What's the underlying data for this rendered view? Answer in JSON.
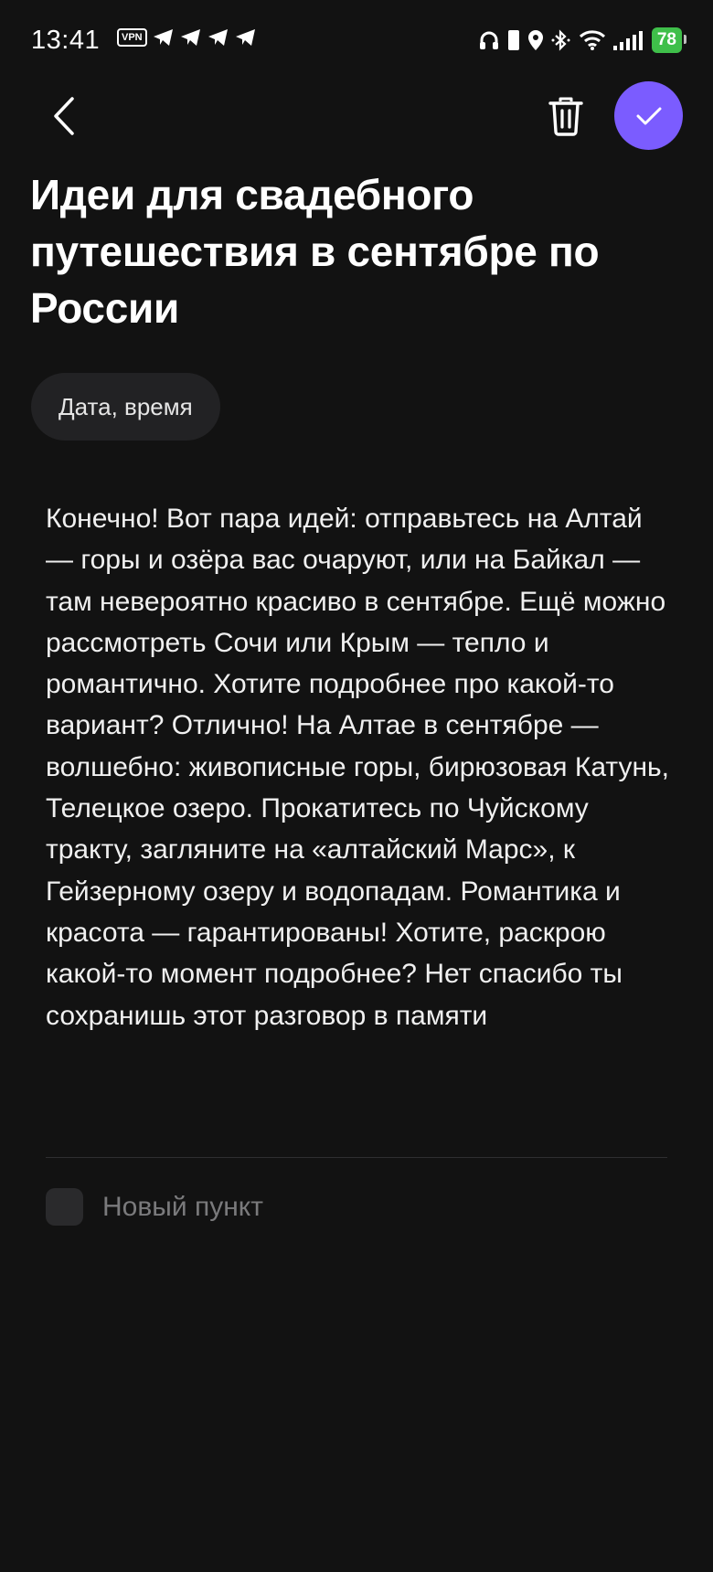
{
  "status_bar": {
    "time": "13:41",
    "vpn_label": "VPN",
    "battery_level": "78",
    "icons": [
      "vpn-icon",
      "telegram-icon",
      "telegram-icon",
      "telegram-icon",
      "telegram-icon",
      "headphones-icon",
      "phone-icon",
      "location-icon",
      "bluetooth-icon",
      "wifi-icon",
      "signal-icon",
      "battery-icon"
    ]
  },
  "header": {
    "back_icon": "chevron-left-icon",
    "delete_icon": "trash-icon",
    "confirm_icon": "check-icon",
    "accent_color": "#7b5cff"
  },
  "note": {
    "title": "Идеи для свадебного путешествия в сентябре по России",
    "date_chip_label": "Дата, время",
    "body": "Конечно! Вот пара идей: отправьтесь на Алтай — горы и озёра вас очаруют, или на Байкал — там невероятно красиво в сентябре. Ещё можно рассмотреть Сочи или Крым — тепло и романтично. Хотите подробнее про какой-то вариант? Отлично! На Алтае в сентябре — волшебно: живописные горы, бирюзовая Катунь, Телецкое озеро. Прокатитесь по Чуйскому тракту, загляните на «алтайский Марс», к Гейзерному озеру и водопадам. Романтика и красота — гарантированы! Хотите, раскрою какой-то момент подробнее? Нет спасибо ты сохранишь этот разговор в памяти",
    "new_item_label": "Новый пункт"
  }
}
